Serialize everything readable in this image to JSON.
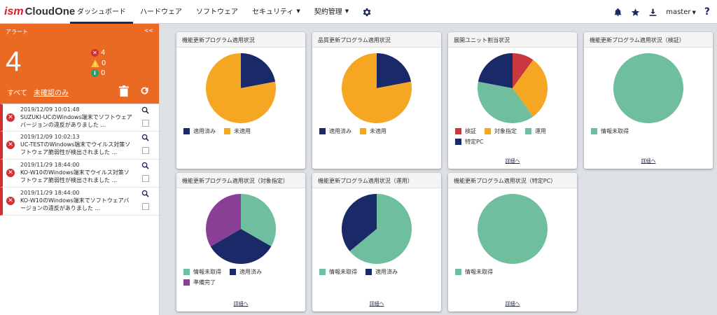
{
  "header": {
    "logo_prefix": "ism",
    "logo_name": "CloudOne",
    "nav": [
      {
        "label": "ダッシュボード",
        "active": true
      },
      {
        "label": "ハードウェア"
      },
      {
        "label": "ソフトウェア"
      },
      {
        "label": "セキュリティ",
        "dropdown": true
      },
      {
        "label": "契約管理",
        "dropdown": true
      }
    ],
    "user": "master",
    "help": "?"
  },
  "alert": {
    "title": "アラート",
    "collapse": "<<",
    "count": "4",
    "error_count": "4",
    "warning_count": "0",
    "info_count": "0",
    "filter_all": "すべて",
    "filter_unread": "未確認のみ",
    "items": [
      {
        "time": "2019/12/09 10:01:48",
        "message": "SUZUKI-UCのWindows端末でソフトウェアバージョンの違反がありました ..."
      },
      {
        "time": "2019/12/09 10:02:13",
        "message": "UC-TESTのWindows端末でウイルス対策ソフトウェア脆弱性が検出されました ..."
      },
      {
        "time": "2019/11/29 18:44:00",
        "message": "KO-W10のWindows端末でウイルス対策ソフトウェア脆弱性が検出されました ..."
      },
      {
        "time": "2019/11/29 18:44:00",
        "message": "KO-W10のWindows端末でソフトウェアバージョンの違反がありました ..."
      }
    ]
  },
  "colors": {
    "navy": "#1a2a68",
    "orange": "#f5a623",
    "red": "#c9383e",
    "green": "#6fbf9f",
    "purple": "#8a3f96",
    "alert_orange": "#ea6a23"
  },
  "cards": [
    {
      "title": "機能更新プログラム適用状況",
      "detail": "",
      "slices": [
        {
          "label": "適用済み",
          "value": 0.22,
          "color": "#1a2a68"
        },
        {
          "label": "未適用",
          "value": 0.78,
          "color": "#f5a623"
        }
      ]
    },
    {
      "title": "品質更新プログラム適用状況",
      "detail": "",
      "slices": [
        {
          "label": "適用済み",
          "value": 0.22,
          "color": "#1a2a68"
        },
        {
          "label": "未適用",
          "value": 0.78,
          "color": "#f5a623"
        }
      ]
    },
    {
      "title": "展開ユニット割当状況",
      "detail": "詳細へ",
      "slices": [
        {
          "label": "検証",
          "value": 0.1,
          "color": "#c9383e"
        },
        {
          "label": "対象指定",
          "value": 0.3,
          "color": "#f5a623"
        },
        {
          "label": "運用",
          "value": 0.38,
          "color": "#6fbf9f"
        },
        {
          "label": "特定PC",
          "value": 0.22,
          "color": "#1a2a68"
        }
      ]
    },
    {
      "title": "機能更新プログラム適用状況（検証）",
      "detail": "詳細へ",
      "slices": [
        {
          "label": "情報未取得",
          "value": 1.0,
          "color": "#6fbf9f"
        }
      ]
    },
    {
      "title": "機能更新プログラム適用状況（対象指定）",
      "detail": "詳細へ",
      "slices": [
        {
          "label": "情報未取得",
          "value": 0.333,
          "color": "#6fbf9f"
        },
        {
          "label": "適用済み",
          "value": 0.333,
          "color": "#1a2a68"
        },
        {
          "label": "準備完了",
          "value": 0.334,
          "color": "#8a3f96"
        }
      ]
    },
    {
      "title": "機能更新プログラム適用状況（運用）",
      "detail": "詳細へ",
      "slices": [
        {
          "label": "情報未取得",
          "value": 0.64,
          "color": "#6fbf9f"
        },
        {
          "label": "適用済み",
          "value": 0.36,
          "color": "#1a2a68"
        }
      ]
    },
    {
      "title": "機能更新プログラム適用状況（特定PC）",
      "detail": "詳細へ",
      "slices": [
        {
          "label": "情報未取得",
          "value": 1.0,
          "color": "#6fbf9f"
        }
      ]
    }
  ]
}
